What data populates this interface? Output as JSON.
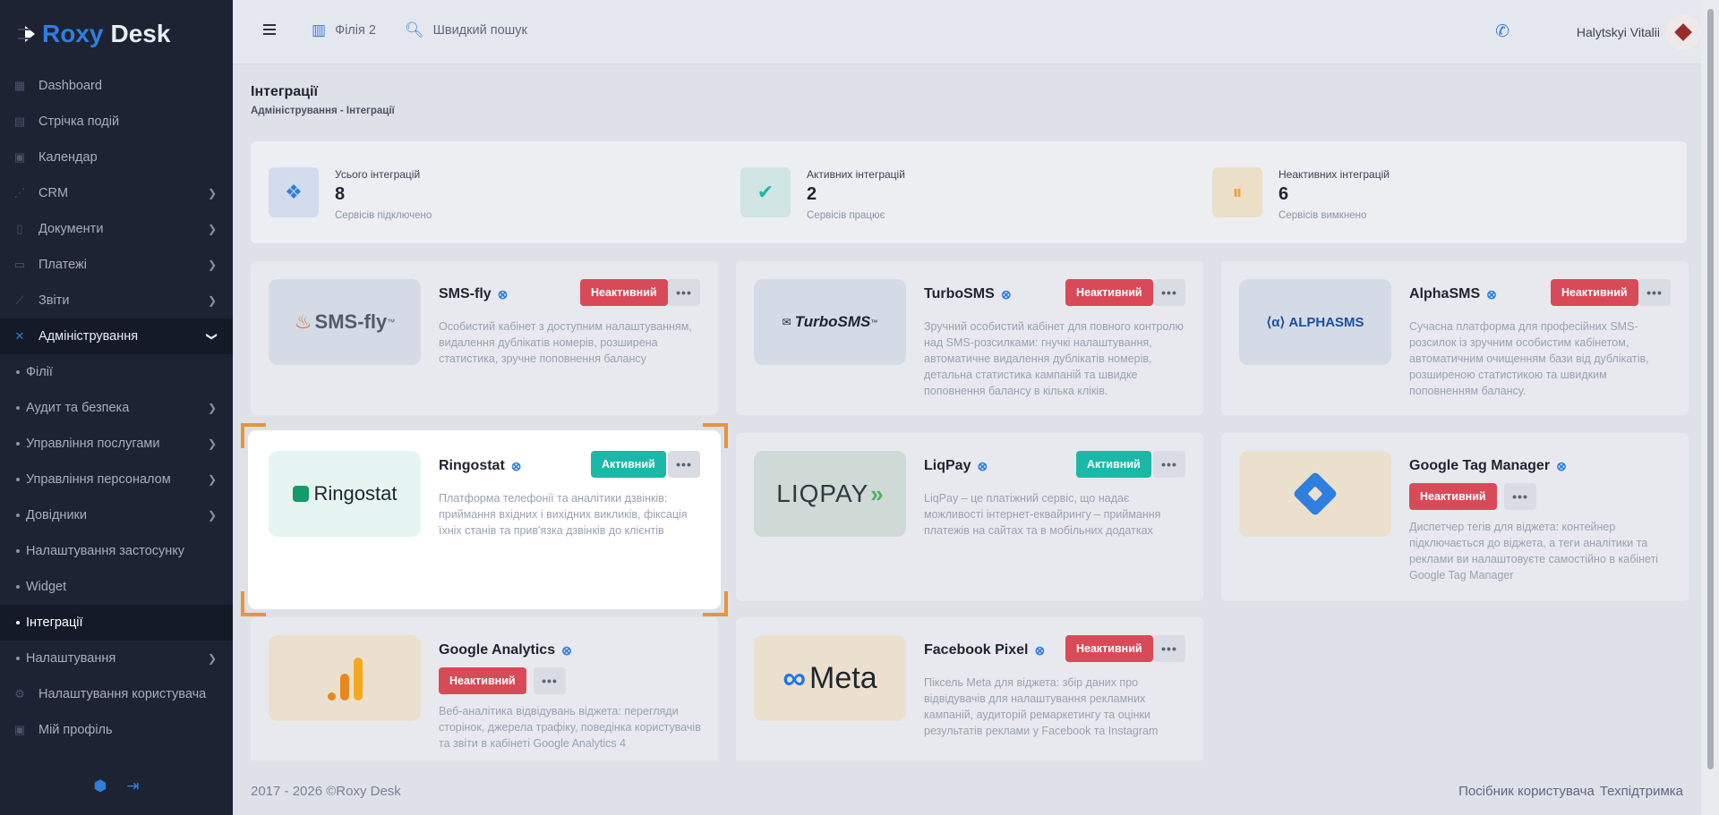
{
  "app": {
    "brand_1": "Roxy",
    "brand_2": "Desk"
  },
  "sidebar": {
    "items": [
      {
        "label": "Dashboard",
        "icon": "dashboard-icon"
      },
      {
        "label": "Стрічка подій",
        "icon": "feed-icon"
      },
      {
        "label": "Календар",
        "icon": "calendar-icon"
      },
      {
        "label": "CRM",
        "icon": "crm-icon",
        "has_children": true
      },
      {
        "label": "Документи",
        "icon": "document-icon",
        "has_children": true
      },
      {
        "label": "Платежі",
        "icon": "payments-icon",
        "has_children": true
      },
      {
        "label": "Звіти",
        "icon": "reports-icon",
        "has_children": true
      },
      {
        "label": "Адміністрування",
        "icon": "tools-icon",
        "expanded": true
      },
      {
        "label": "Філії",
        "sub": true
      },
      {
        "label": "Аудит та безпека",
        "sub": true,
        "has_children": true
      },
      {
        "label": "Управління послугами",
        "sub": true,
        "has_children": true
      },
      {
        "label": "Управління персоналом",
        "sub": true,
        "has_children": true
      },
      {
        "label": "Довідники",
        "sub": true,
        "has_children": true
      },
      {
        "label": "Налаштування застосунку",
        "sub": true
      },
      {
        "label": "Widget",
        "sub": true
      },
      {
        "label": "Інтеграції",
        "sub": true,
        "current": true
      },
      {
        "label": "Налаштування",
        "sub": true,
        "has_children": true
      },
      {
        "label": "Налаштування користувача",
        "icon": "user-settings-icon"
      },
      {
        "label": "Мій профіль",
        "icon": "profile-icon"
      }
    ]
  },
  "topbar": {
    "branch": "Філія 2",
    "search": "Швидкий пошук",
    "user": "Halytskyi Vitalii"
  },
  "page": {
    "title": "Інтеграції",
    "breadcrumb": "Адміністрування - Інтеграції"
  },
  "stats": [
    {
      "label": "Усього інтеграцій",
      "value": "8",
      "sub": "Сервісів підключено",
      "color": "#2f7fe0"
    },
    {
      "label": "Активних інтеграцій",
      "value": "2",
      "sub": "Сервісів працює",
      "color": "#1bb8a8"
    },
    {
      "label": "Неактивних інтеграцій",
      "value": "6",
      "sub": "Сервісів вимкнено",
      "color": "#e8a33a"
    }
  ],
  "integrations": [
    {
      "name": "SMS-fly",
      "status": "Неактивний",
      "logo_text": "SMS-fly",
      "logo_tm": "™",
      "desc": "Особистий кабінет з доступним налаштуванням, видалення дублікатів номерів, розширена статистика, зручне поповнення балансу"
    },
    {
      "name": "TurboSMS",
      "status": "Неактивний",
      "logo_text": "TurboSMS",
      "logo_tm": "™",
      "desc": "Зручний особистий кабінет для повного контролю над SMS-розсилками: гнучкі налаштування, автоматичне видалення дублікатів номерів, детальна статистика кампаній та швидке поповнення балансу в кілька кліків."
    },
    {
      "name": "AlphaSMS",
      "status": "Неактивний",
      "logo_text": "ALPHASMS",
      "desc": "Сучасна платформа для професійних SMS-розсилок із зручним особистим кабінетом, автоматичним очищенням бази від дублікатів, розширеною статистикою та швидким поповненням балансу."
    },
    {
      "name": "Ringostat",
      "status": "Активний",
      "logo_text": "Ringostat",
      "desc": "Платформа телефонії та аналітики дзвінків: приймання вхідних і вихідних викликів, фіксація їхніх станів та прив'язка дзвінків до клієнтів"
    },
    {
      "name": "LiqPay",
      "status": "Активний",
      "logo_text": "LIQPAY",
      "desc": "LiqPay – це платіжний сервіс, що надає можливості інтернет-еквайрингу – приймання платежів на сайтах та в мобільних додатках"
    },
    {
      "name": "Google Tag Manager",
      "status": "Неактивний",
      "desc": "Диспетчер тегів для віджета: контейнер підключається до віджета, а теги аналітики та реклами ви налаштовуєте самостійно в кабінеті Google Tag Manager"
    },
    {
      "name": "Google Analytics",
      "status": "Неактивний",
      "desc": "Веб-аналітика відвідувань віджета: перегляди сторінок, джерела трафіку, поведінка користувачів та звіти в кабінеті Google Analytics 4"
    },
    {
      "name": "Facebook Pixel",
      "status": "Неактивний",
      "logo_text": "Meta",
      "desc": "Піксель Meta для віджета: збір даних про відвідувачів для налаштування рекламних кампаній, аудиторій ремаркетингу та оцінки результатів реклами у Facebook та Instagram"
    }
  ],
  "footer": {
    "copyright": "2017 - 2026 ©Roxy Desk",
    "guide": "Посібник користувача",
    "support": "Техпідтримка"
  },
  "colors": {
    "accent": "#2f7fe0",
    "active": "#1bb8a8",
    "inactive": "#d94a58",
    "selection": "#e8943a",
    "sidebar": "#1d2333"
  }
}
